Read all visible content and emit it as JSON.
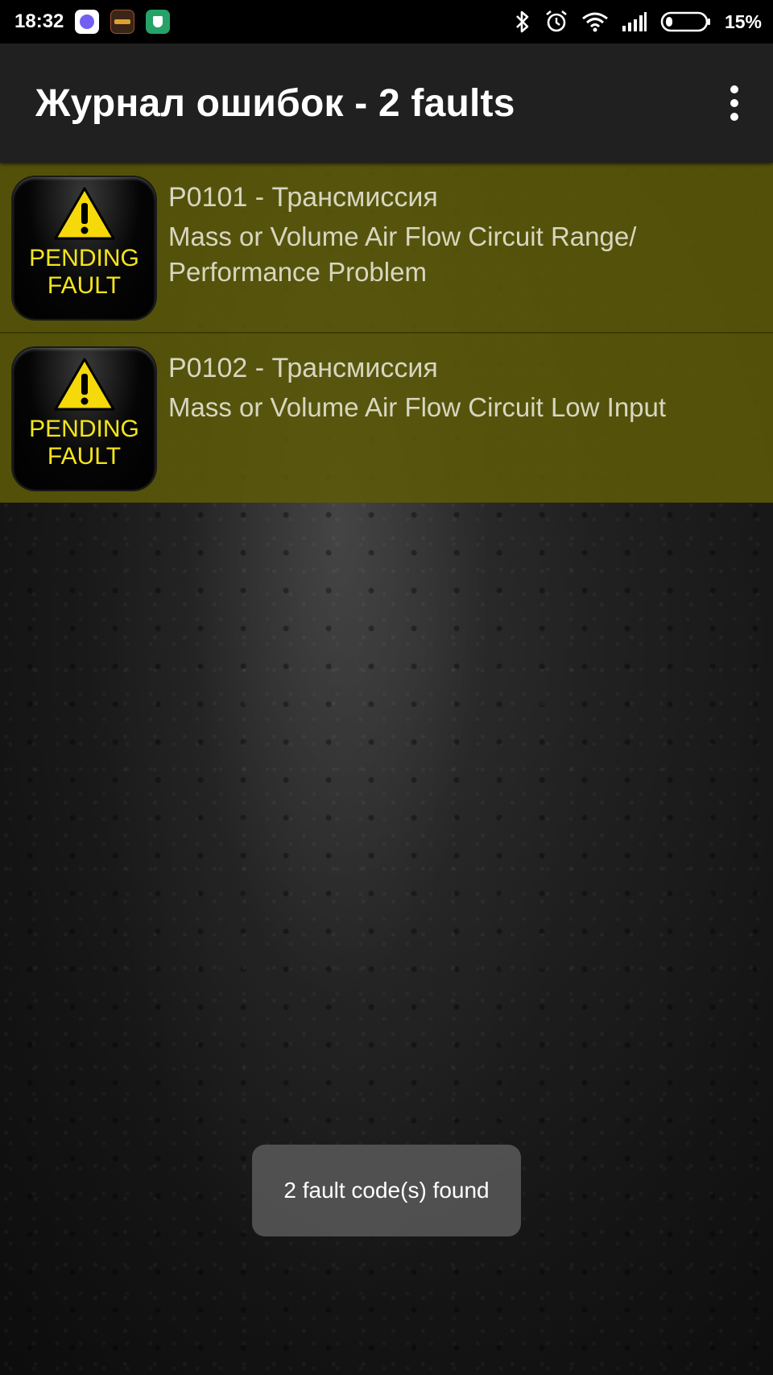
{
  "status_bar": {
    "time": "18:32",
    "battery": "15%",
    "notification_icons": [
      "viber-icon",
      "game-icon",
      "shield-icon"
    ],
    "system_icons": [
      "bluetooth-icon",
      "alarm-icon",
      "wifi-icon",
      "signal-icon",
      "battery-icon"
    ]
  },
  "app_bar": {
    "title": "Журнал ошибок - 2 faults"
  },
  "faults": [
    {
      "badge_line1": "PENDING",
      "badge_line2": "FAULT",
      "code": "P0101 - Трансмиссия",
      "description": "Mass or Volume Air Flow Circuit Range/ Performance Problem"
    },
    {
      "badge_line1": "PENDING",
      "badge_line2": "FAULT",
      "code": "P0102 - Трансмиссия",
      "description": "Mass or Volume Air Flow Circuit Low Input"
    }
  ],
  "toast": {
    "message": "2 fault code(s) found"
  },
  "colors": {
    "fault_row_bg": "#5c5a08",
    "badge_text": "#f5e51a",
    "warning_triangle": "#f5d90a",
    "app_bar_bg": "#202020"
  }
}
